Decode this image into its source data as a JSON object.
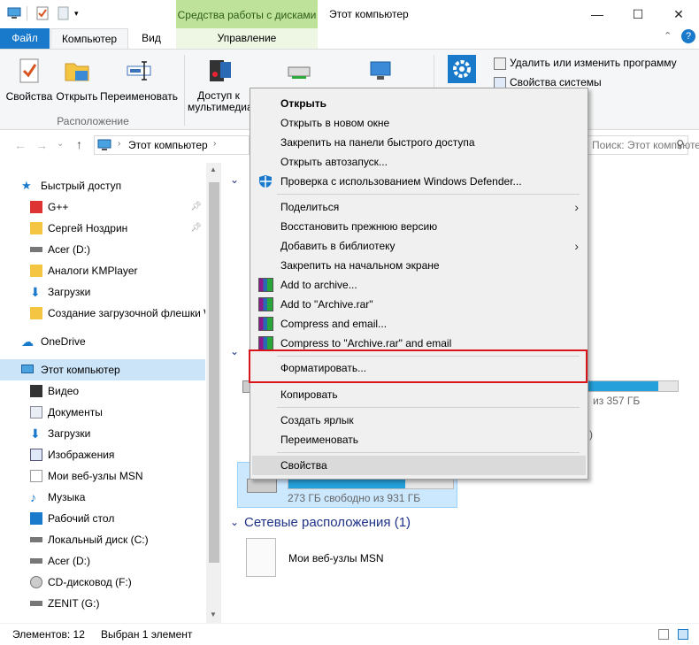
{
  "window": {
    "title": "Этот компьютер",
    "context_group": "Средства работы с дисками",
    "controls": [
      "—",
      "☐",
      "✕"
    ]
  },
  "tabs": {
    "file": "Файл",
    "computer": "Компьютер",
    "view": "Вид",
    "manage": "Управление"
  },
  "ribbon": {
    "properties": "Свойства",
    "open": "Открыть",
    "rename": "Переименовать",
    "media_access": "Доступ к",
    "media_access_2": "мультимедиа",
    "group_location": "Расположение",
    "uninstall": "Удалить или изменить программу",
    "system_props": "Свойства системы"
  },
  "address": {
    "path": "Этот компьютер",
    "search_placeholder": "Поиск: Этот компьютер"
  },
  "nav": {
    "quick_access": "Быстрый доступ",
    "items_quick": [
      "G++",
      "Сергей Ноздрин",
      "Acer (D:)",
      "Аналоги KMPlayer",
      "Загрузки",
      "Создание загрузочной флешки W"
    ],
    "onedrive": "OneDrive",
    "this_pc": "Этот компьютер",
    "items_pc": [
      "Видео",
      "Документы",
      "Загрузки",
      "Изображения",
      "Мои веб-узлы MSN",
      "Музыка",
      "Рабочий стол",
      "Локальный диск (C:)",
      "Acer (D:)",
      "CD-дисковод (F:)",
      "ZENIT (G:)"
    ]
  },
  "content": {
    "drive_free_1": "из 357 ГБ",
    "drive_free_sel": "273 ГБ свободно из 931 ГБ",
    "drive_fill_1": 0.78,
    "drive_fill_sel": 0.71,
    "network_header": "Сетевые расположения (1)",
    "network_item": "Мои веб-узлы MSN"
  },
  "context_menu": {
    "items": [
      "Открыть",
      "Открыть в новом окне",
      "Закрепить на панели быстрого доступа",
      "Открыть автозапуск...",
      "Проверка с использованием Windows Defender...",
      "Поделиться",
      "Восстановить прежнюю версию",
      "Добавить в библиотеку",
      "Закрепить на начальном экране",
      "Add to archive...",
      "Add to \"Archive.rar\"",
      "Compress and email...",
      "Compress to \"Archive.rar\" and email",
      "Форматировать...",
      "Копировать",
      "Создать ярлык",
      "Переименовать",
      "Свойства"
    ]
  },
  "status": {
    "count": "Элементов: 12",
    "selected": "Выбран 1 элемент"
  },
  "colors": {
    "accent": "#1979ca",
    "highlight_box": "#d9141b",
    "context_tab": "#bfe29a",
    "progress": "#26a0da"
  }
}
